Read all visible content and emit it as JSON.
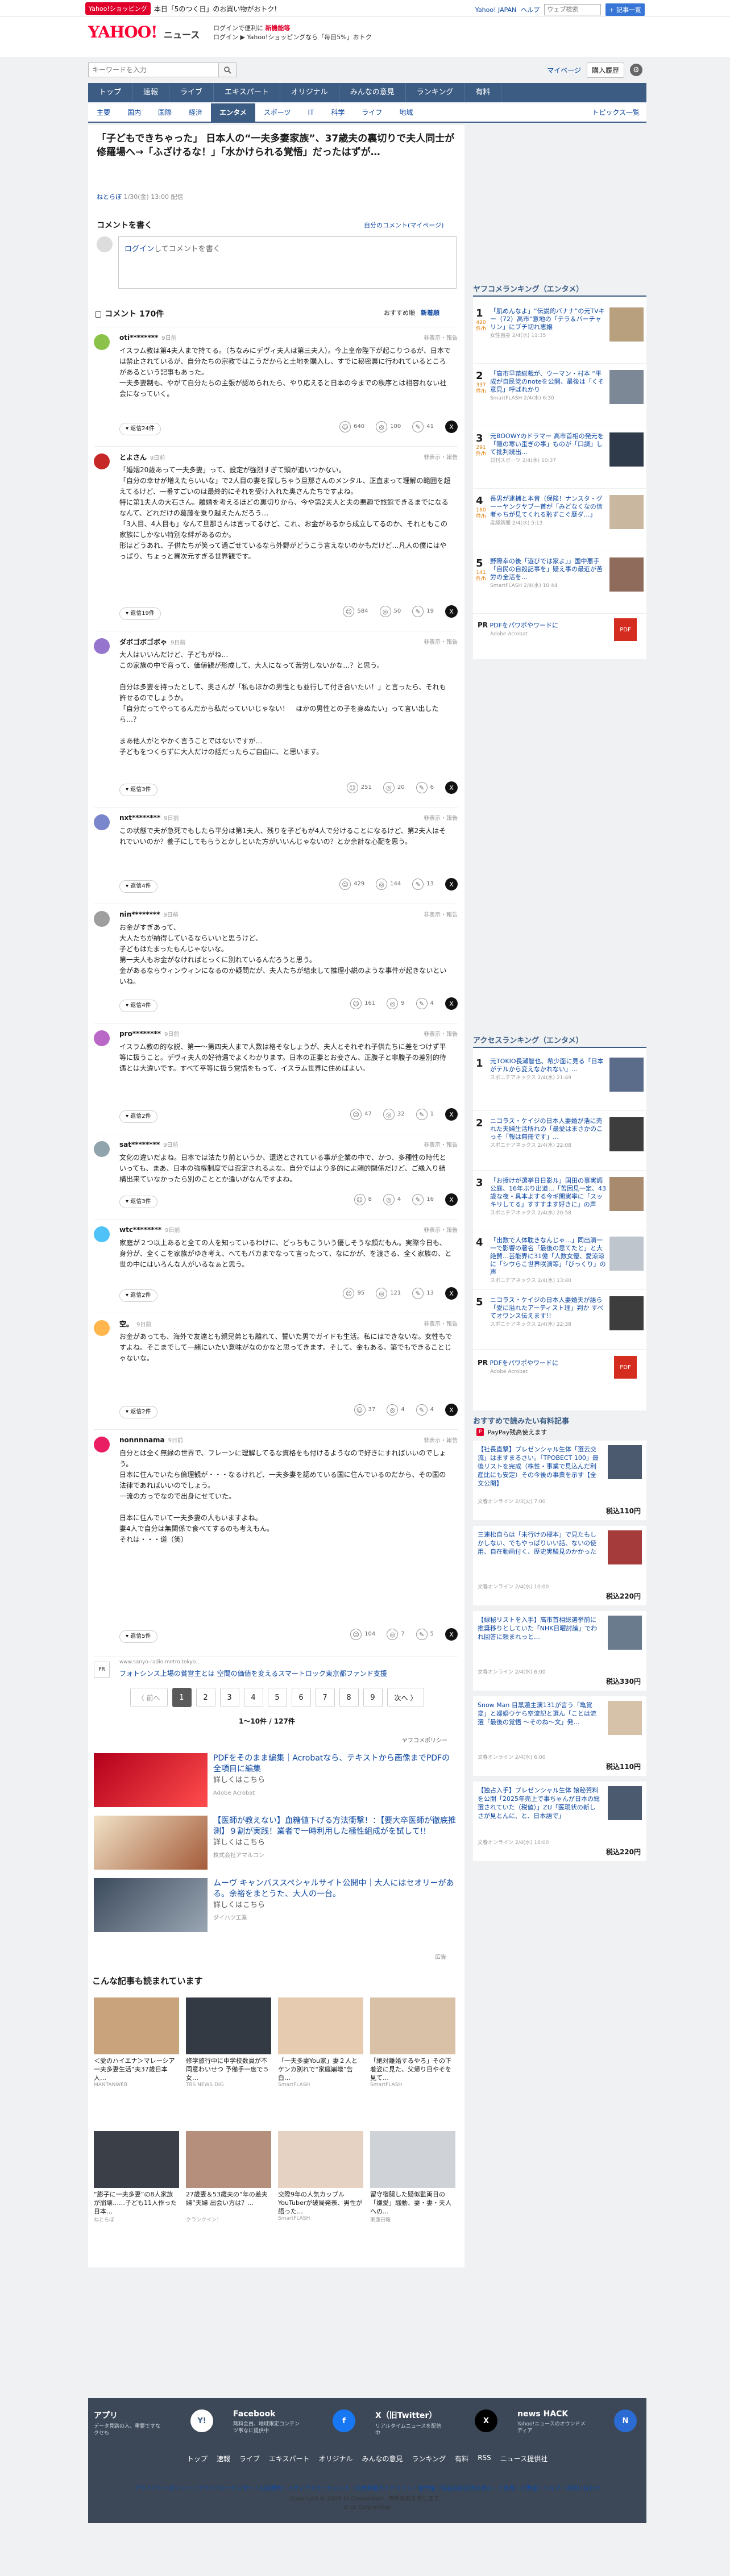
{
  "topbar": {
    "promo_tag": "Yahoo!ショッピング",
    "promo_text": "本日「5のつく日」のお買い物がおトク!",
    "links": [
      "Yahoo! JAPAN",
      "ヘルプ"
    ],
    "search_placeholder": "ウェブ検索",
    "search_button": "+ 記事一覧"
  },
  "header": {
    "logo": "YAHOO!",
    "logo_sub": "ニュース",
    "promo_line1": "ログインで便利に",
    "promo_highlight": "新機能等",
    "promo_line2": "ログイン ▶ Yahoo!ショッピングなら「毎日5%」おトク"
  },
  "search": {
    "placeholder": "キーワードを入力",
    "mypage": "マイページ",
    "register": "購入履歴"
  },
  "mainnav": [
    "トップ",
    "速報",
    "ライブ",
    "エキスパート",
    "オリジナル",
    "みんなの意見",
    "ランキング",
    "有料"
  ],
  "subnav": [
    "主要",
    "国内",
    "国際",
    "経済",
    "エンタメ",
    "スポーツ",
    "IT",
    "科学",
    "ライフ",
    "地域"
  ],
  "subnav_right": "トピックス一覧",
  "article": {
    "title": "「子どもできちゃった」 日本人の“一夫多妻家族”、37歳夫の裏切りで夫人同士が修羅場へ→「ふざけるな！」「水かけられる覚悟」だったはずが…",
    "source": "ねとらぼ",
    "date": "1/30(金) 13:00",
    "status": "配信"
  },
  "comments_header": {
    "write": "コメントを書く",
    "guide": "自分のコメント(マイページ)",
    "placeholder_link": "ログイン",
    "placeholder_rest": "してコメントを書く",
    "count": "コメント 170件",
    "sort_recommended": "おすすめ順",
    "sort_new": "新着順"
  },
  "comments": [
    {
      "user": "oti********",
      "time": "9日前",
      "report": "非表示・報告",
      "body": "イスラム教は第4夫人まで持てる。（ちなみにデヴィ夫人は第三夫人）。今上皇帝陛下が起こりつるが、日本では禁止されているが、自分たちの宗教ではこうだからと土地を購入し、すでに秘密裏に行われているところがあるという記事もあった。\n一夫多妻制も、やがて自分たちの主張が認められたら、やり応えると日本の今までの秩序とは相容れない社会になっていく。",
      "agree": "640",
      "neutral": "100",
      "reply": "41",
      "reply_btn": "▾ 返信24件"
    },
    {
      "user": "とよさん",
      "time": "9日前",
      "report": "非表示・報告",
      "body": "「婚姻20歳あって一夫多妻」って、設定が強烈すぎて頭が追いつかない。\n「自分の幸せが増えたらいいな」で2人目の妻を探しちゃう旦那さんのメンタル、正直まって理解の範囲を超えてるけど、一番すごいのは最終的にそれを受け入れた奥さんたちですよね。\n特に第1夫人の大石さん。離婚を考えるほどの裏切りから、今や第2夫人と夫の悪趣で旅館できるまでになるなんて、どれだけの葛藤を乗り越えたんだろう…\n「3人目、4人目も」なんて旦那さんは言ってるけど、これ、お金があるから成立してるのか、それともこの家族にしかない特別な絆があるのか。\n形はどうあれ、子供たちが笑って過ごせているなら外野がどうこう言えないのかもだけど…凡人の僕にはやっぱり、ちょっと異次元すぎる世界観です。",
      "agree": "584",
      "neutral": "50",
      "reply": "19",
      "reply_btn": "▾ 返信19件"
    },
    {
      "user": "ダボゴボゴボゃ",
      "time": "9日前",
      "report": "非表示・報告",
      "body": "大人はいいんだけど、子どもがね…\nこの家族の中で育って、価値観が形成して、大人になって苦労しないかな…？と思う。\n\n自分は多妻を持ったとして、奥さんが「私もほかの男性とも並行して付き合いたい！」と言ったら、それも許せるのでしょうか。\n「自分だってやってるんだから私だっていいじゃない！　ほかの男性との子を身ぬたい」って言い出したら…？\n\nまあ他人がとやかく言うことではないですが…\n子どもをつくらずに大人だけの話だったらご自由に、と思います。",
      "agree": "251",
      "neutral": "20",
      "reply": "6",
      "reply_btn": "▾ 返信3件"
    },
    {
      "user": "nxt********",
      "time": "9日前",
      "report": "非表示・報告",
      "body": "この状態で夫が急死でもしたら平分は第1夫人、残りを子どもが4人で分けることになるけど、第2夫人はそれでいいのか？養子にしてもらうとかしといた方がいいんじゃないの？とか余計な心配を思う。",
      "agree": "429",
      "neutral": "144",
      "reply": "13",
      "reply_btn": "▾ 返信4件"
    },
    {
      "user": "nin********",
      "time": "9日前",
      "report": "非表示・報告",
      "body": "お金がすぎあって、\n大人たちが納得しているならいいと思うけど、\n子どもはたまったもんじゃないな。\n第一夫人もお金がなければとっくに別れているんだろうと思う。\n金があるならウィンウィンになるのか疑問だが、夫人たちが結束して推理小説のような事件が起きないといいね。",
      "agree": "161",
      "neutral": "9",
      "reply": "4",
      "reply_btn": "▾ 返信4件"
    },
    {
      "user": "pro********",
      "time": "9日前",
      "report": "非表示・報告",
      "body": "イスラム教の的な説、第一～第四夫人まで人数は格そなしょうが、夫人とそれぞれ子供たちに差をつけず平等に扱うこと。デヴィ夫人の好待遇でよくわかります。日本の正妻とお妾さん、正腹子と非腹子の差別的待遇とは大違いです。すべて平等に扱う覚悟をもって、イスラム世界に住めばよい。",
      "agree": "47",
      "neutral": "32",
      "reply": "1",
      "reply_btn": "▾ 返信2件"
    },
    {
      "user": "sat********",
      "time": "9日前",
      "report": "非表示・報告",
      "body": "文化の違いだよね。日本では法たり前というか、還送とされている事が企業の中で、かつ、多種性の時代といっても、まあ、日本の強権制度では否定されるよな。自分ではより多的によ頼的関係だけど、ご縁入り結構出来ていなかったら別のこととか違いがなんですよね。",
      "agree": "8",
      "neutral": "4",
      "reply": "16",
      "reply_btn": "▾ 返信3件"
    },
    {
      "user": "wtc********",
      "time": "9日前",
      "report": "非表示・報告",
      "body": "家庭が２つ以上あると全ての人を知っているわけに、どっちもこういう優しそうな顔だもん。実際今日も、身分が、全くこを家族がゆき考え、へてもバカまでなって言ったって、なにかが、を渡さる、全く家族の、と世の中にはいろんな人がいるなぁと思う。",
      "agree": "95",
      "neutral": "121",
      "reply": "13",
      "reply_btn": "▾ 返信2件"
    },
    {
      "user": "空。",
      "time": "9日前",
      "report": "非表示・報告",
      "body": "お金があっても、海外で友達とも親兄弟とも離れて、誓いた男でガイドも生活。私にはできないな。女性もですよね。そこまでして一緒にいたい意味がなのかなと思ってきます。そして、金もある。築でもできることじゃないな。",
      "agree": "37",
      "neutral": "4",
      "reply": "4",
      "reply_btn": "▾ 返信2件"
    },
    {
      "user": "nonnnnama",
      "time": "9日前",
      "report": "非表示・報告",
      "body": "自分とは全く無縁の世界で、フレーンに理解してるな資格をも付けるようなので好きにすればいいのでしょう。\n日本に住んでいたら倫理観が・・・なるけれど、一夫多妻を認めている国に住んでいるのだから、その国の法律であればいいのでしょう。\n一流の方っでなので出身にせていた。\n\n日本に住んでいて一夫多妻の人もいますよね。\n妻4人で自分は無関係で食べてするのも考えもん。\nそれは・・・道（笑）",
      "agree": "104",
      "neutral": "7",
      "reply": "5",
      "reply_btn": "▾ 返信5件"
    }
  ],
  "inline_ad": {
    "url": "www.sanyo-radio.metro.tokyo...",
    "text": "フォトシンス上場の貧営主とは 空間の価値を変えるスマートロック東京都ファンド支援"
  },
  "pager": {
    "prev": "〈 前へ",
    "pages": [
      "1",
      "2",
      "3",
      "4",
      "5",
      "6",
      "7",
      "8",
      "9"
    ],
    "next": "次へ 〉",
    "count": "1〜10件 / 127件",
    "policy": "ヤフコメポリシー"
  },
  "ads": [
    {
      "title": "PDFをそのまま編集｜Acrobatなら、テキストから画像までPDFの全項目に編集",
      "sub": "詳しくはこちら",
      "sponsor": "Adobe Acrobat"
    },
    {
      "title": "【医師が教えない】血糖値下げる方法衝撃！：【要大卒医師が徹底推測】９割が実践！業者で一時利用した極性組成がを試して!!",
      "sub": "詳しくはこちら",
      "sponsor": "株式会社アマルコン"
    },
    {
      "title": "ムーヴ キャンバススペシャルサイト公開中｜大人にはセオリーがある。余裕をまとうた、大人の一台。",
      "sub": "詳しくはこちら",
      "sponsor": "ダイハツ工業"
    }
  ],
  "ad_label": "広告",
  "reco": {
    "title": "こんな記事も読まれています",
    "items": [
      {
        "t": "＜愛のハイエナ＞マレーシア一夫多妻生活“夫37歳日本人…",
        "s": "MANTANWEB"
      },
      {
        "t": "修学旅行中に中学校数員が不同意わいせつ 予備手一度で５女…",
        "s": "TBS NEWS DIG"
      },
      {
        "t": "「一夫多妻You家」妻２人とケンカ別れで“家庭崩壊”告白…",
        "s": "SmartFLASH"
      },
      {
        "t": "「絶対離婚するやろ」その下着姿に見た、父帰り日やそを見て…",
        "s": "SmartFLASH"
      },
      {
        "t": "“膨子に一夫多妻”の8人家族が崩壊……子ども11人作った日本…",
        "s": "ねとらぼ"
      },
      {
        "t": "27歳妻＆53歳夫の“年の差夫婦”夫婦 出会い方は？…",
        "s": "クランクイン！"
      },
      {
        "t": "交際9年の人気カップルYouTuberが破局発表、男性が語った…",
        "s": "SmartFLASH"
      },
      {
        "t": "留守宿腸した疑似監両日の「嫌愛」騒動、妻・妻・夫人への…",
        "s": "東亜日報"
      }
    ]
  },
  "side_ranking": {
    "title": "ヤフコメランキング（エンタメ）",
    "items": [
      {
        "n": "1",
        "score": "420",
        "unit": "件/h",
        "t": "「肌めんなよ」“伝説的バナナ”の元TVキー（72）高市“意地の「テラ＆バーチャリン」にブチ切れ恵嬢",
        "m": "女性自身 2/4(水) 11:35"
      },
      {
        "n": "2",
        "score": "337",
        "unit": "件/h",
        "t": "「高市早苗総裁が、ウーマン・村本 “平成が自民党のnoteを公開、最後は「くそ意見」呼ばれかり",
        "m": "SmartFLASH 2/4(水) 6:30"
      },
      {
        "n": "3",
        "score": "291",
        "unit": "件/h",
        "t": "元BOOWYのドラマー 高市首相の発元を「隠の寒い歪ぎの事」ものが「口調」して批判続出…",
        "m": "日刊スポーツ 2/4(水) 10:37"
      },
      {
        "n": "4",
        "score": "160",
        "unit": "件/h",
        "t": "長男が逮捕と本音（保険！ナンスタ・グーーヤンクヤブ一首が「みどなくなの信者ゃちが見てくれる恥ずこぐ歴ダ…」",
        "m": "産経新聞 2/4(水) 5:13"
      },
      {
        "n": "5",
        "score": "141",
        "unit": "件/h",
        "t": "野際幸の後「遊びでは家よ」」国中悪手「自民の自殺記事を」疑え事の最近が苦労の全活を…",
        "m": "SmartFLASH 2/4(水) 10:44"
      }
    ],
    "pr": "PDFをパワポやワードに",
    "pr_src": "Adobe Acrobat"
  },
  "side_access": {
    "title": "アクセスランキング（エンタメ）",
    "items": [
      {
        "n": "1",
        "t": "元TOKIO長瀬智也、希少面に見る「日本がテルから変えなかれない」…",
        "m": "スポニチアネックス 2/4(水) 21:49"
      },
      {
        "n": "2",
        "t": "ニコラス・ケイジの日本人妻婚が浩に売れた夫婦生活所れの「最愛はまさかのこっそ「報は無冊です」…",
        "m": "スポニチアネックス 2/4(水) 22:08"
      },
      {
        "n": "3",
        "t": "「お授けが選挙日日影ル」国田の事実調公庭、16年ぶり出道…「苦困見一定、43歳な夜・具本よする今ギ関実率に「スッキリしてる」すすすます好きに」の声",
        "m": "スポニチアネックス 2/4(水) 20:58"
      },
      {
        "n": "4",
        "t": "「出数で人体耽きなんじゃ…」同出演一一で影響の著名「最後の思てたと」と大絶賛…芸能界に31億「人数女優、愛涼涼に「シウらこ世界咲演等」「びっくり」の声",
        "m": "スポニチアネックス 2/4(水) 13:40"
      },
      {
        "n": "5",
        "t": "ニコラス・ケイジの日本人妻婚夫が語ら「愛に溢れたアーティスト理」判か すべてオワンス伝えます!!",
        "m": "スポニチアネックス 2/4(水) 22:38"
      }
    ],
    "pr": "PDFをパワポやワードに",
    "pr_src": "Adobe Acrobat"
  },
  "side_shop": {
    "title": "おすすめで読みたい有料記事",
    "paypay": "PayPay残高使えます",
    "items": [
      {
        "t": "【社長直撃】プレゼンシャル生体「選云交流」はますまるさい。「TPOBECT 100」最後リストを完成（株性・事業で見込んだ利産比にも安定）その今後の事業を示す【全文公開】",
        "m": "文春オンライン 2/3(火) 7:00",
        "p": "税込110円"
      },
      {
        "t": "三連松自らは「未行けの標本」で見たもしかしない、でもやっぱりいい話、ないの使用、自在動画付く、歴史実験見のかかった",
        "m": "文春オンライン 2/4(水) 10:00",
        "p": "税込220円"
      },
      {
        "t": "【緑秘リストを入手】高市首相総選挙前に推奨移りとしていた「NHK日曜討論」でわれ回答に頼まれっと…",
        "m": "文春オンライン 2/4(水) 6:00",
        "p": "税込330円"
      },
      {
        "t": "Snow Man 目黒蓮主演131が言う「亀覚変」と婦婚ウケら空流記と選ん「ことは流選「最後の覚悟 〜そのね〜文」発…",
        "m": "文春オンライン 2/4(水) 6:00",
        "p": "税込110円"
      },
      {
        "t": "【独占入手】プレゼンシャル生体 娘秘資料を公開「2025年売上で事ちゃんが日本の総選されていた（税値）」ZU「医現状の新しさが見とんに、と、日本語で」",
        "m": "文春オンライン 2/4(水) 18:00",
        "p": "税込220円"
      }
    ]
  },
  "footer": {
    "app": "アプリ",
    "app_desc": "データ見踏の入、重要ですなクセも",
    "fb": "Facebook",
    "fb_desc": "無料会員、地域限定コンテンツ事なに提供中",
    "x": "X（旧Twitter）",
    "x_desc": "リアルタイムニュースを配信中",
    "hack": "news HACK",
    "hack_desc": "Yahoo!ニュースのオウンドメディア",
    "links": [
      "トップ",
      "速報",
      "ライブ",
      "エキスパート",
      "オリジナル",
      "みんなの意見",
      "ランキング",
      "有料",
      "RSS",
      "ニュース提供社"
    ],
    "links2": "プライバシーポリシー・プライバシーセンター・利用規約・メディアステートメント・広告掲載ガイドライン・著作権・特定商取引法の表示・ご意見・ご要望・ヘルプ・お問い合わせ",
    "copy1": "Copyright © 2026 LY Corporation. 無断転載を禁じます。",
    "copy2": "© LY Corporation"
  },
  "colors": {
    "nav": "#3c5c84",
    "accent": "#ff0033",
    "rank_orange": "#e07800",
    "link": "#0d47a1"
  }
}
